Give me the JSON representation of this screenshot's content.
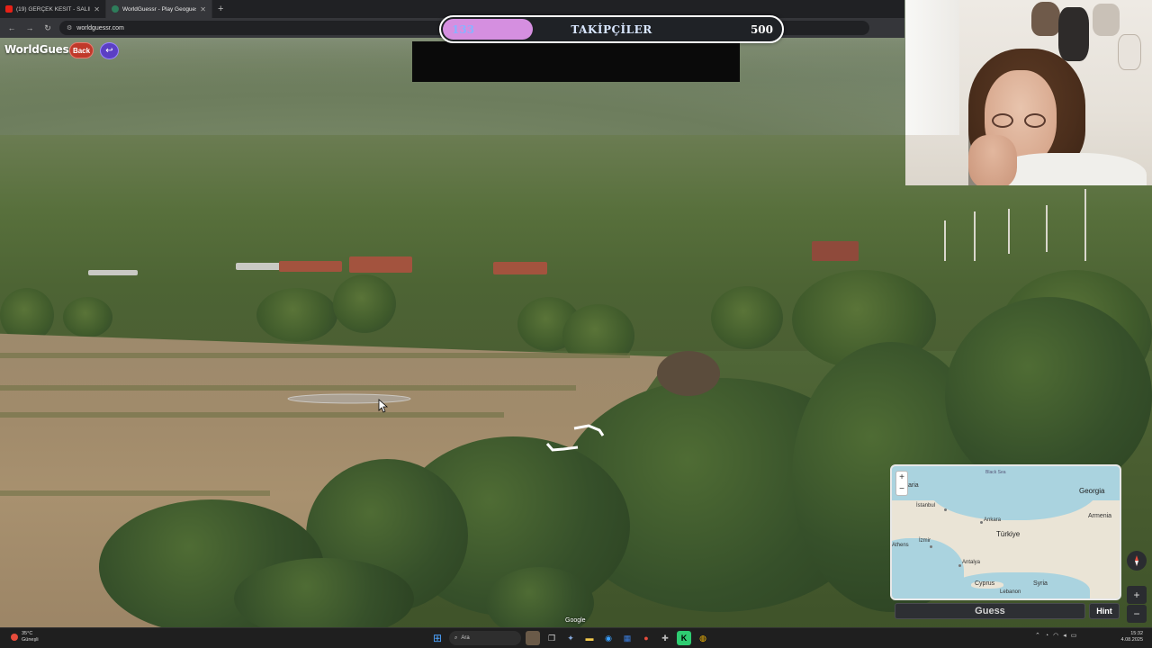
{
  "browser": {
    "tabs": [
      {
        "label": "(19) GERÇEK KESİT - SALINCAK",
        "icon": "youtube-icon",
        "active": false
      },
      {
        "label": "WorldGuessr - Play Geoguessr",
        "icon": "worldguessr-icon",
        "active": true
      }
    ],
    "url": "worldguessr.com"
  },
  "game": {
    "logo": "WorldGuessr",
    "back_label": "Back",
    "google_mark": "Google",
    "guess_label": "Guess",
    "hint_label": "Hint"
  },
  "follower_goal": {
    "current": "133",
    "label": "TAKİPÇİLER",
    "target": "500",
    "progress_fraction": 0.266
  },
  "map": {
    "sea_label": "Black Sea",
    "labels": {
      "bulgaria": "Bulgaria",
      "istanbul": "İstanbul",
      "ankara": "Ankara",
      "turkiye": "Türkiye",
      "izmir": "İzmir",
      "athens": "Athens",
      "antalya": "Antalya",
      "georgia": "Georgia",
      "armenia": "Armenia",
      "cyprus": "Cyprus",
      "syria": "Syria",
      "lebanon": "Lebanon"
    }
  },
  "taskbar": {
    "weather_temp": "35°C",
    "weather_desc": "Güneşli",
    "search_label": "Ara",
    "time": "15:32",
    "date": "4.08.2025"
  },
  "colors": {
    "back_button": "#c0392b",
    "return_button": "#5b3fc4",
    "goal_fill": "#d58fe0",
    "goal_current_text": "#8ab2ff"
  }
}
